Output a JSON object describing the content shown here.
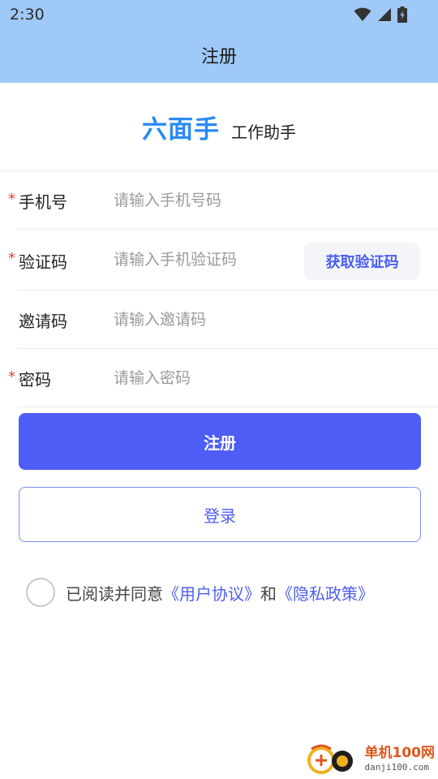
{
  "status_bar": {
    "time": "2:30",
    "icons": [
      "wifi-icon",
      "signal-icon",
      "battery-icon"
    ]
  },
  "header": {
    "title": "注册"
  },
  "brand": {
    "name": "六面手",
    "subtitle": "工作助手"
  },
  "form": {
    "phone": {
      "label": "手机号",
      "placeholder": "请输入手机号码",
      "required": true,
      "value": ""
    },
    "code": {
      "label": "验证码",
      "placeholder": "请输入手机验证码",
      "required": true,
      "value": "",
      "button_label": "获取验证码"
    },
    "invite": {
      "label": "邀请码",
      "placeholder": "请输入邀请码",
      "required": false,
      "value": ""
    },
    "password": {
      "label": "密码",
      "placeholder": "请输入密码",
      "required": true,
      "value": ""
    },
    "required_mark": "*"
  },
  "actions": {
    "register_label": "注册",
    "login_label": "登录"
  },
  "agreement": {
    "checked": false,
    "prefix": "已阅读并同意",
    "user_agreement": "《用户协议》",
    "conjunction": "和",
    "privacy_policy": "《隐私政策》"
  },
  "watermark": {
    "main": "单机100网",
    "sub": "danji100.com"
  },
  "colors": {
    "header_bg": "#9fc9f7",
    "brand": "#2a8af5",
    "primary": "#4d5df5",
    "required": "#e8403a",
    "placeholder": "#9a9a9a"
  }
}
